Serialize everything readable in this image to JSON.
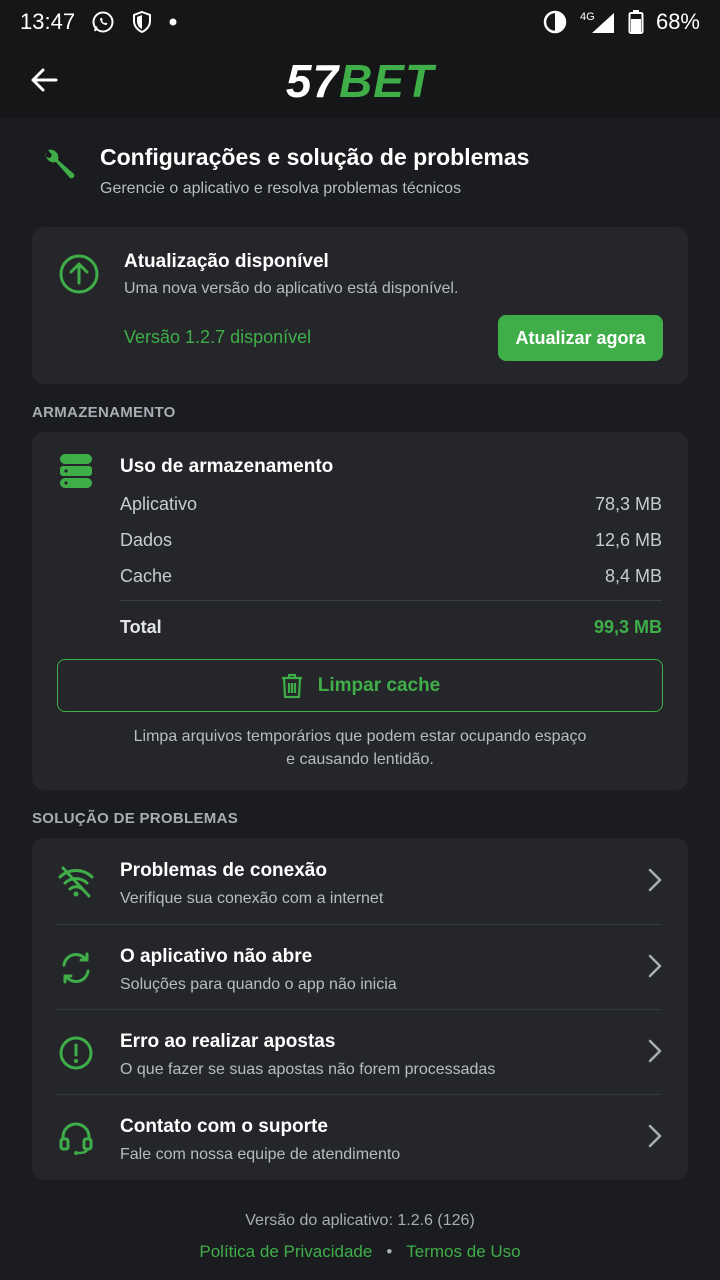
{
  "status_bar": {
    "time": "13:47",
    "network": "4G",
    "battery": "68%"
  },
  "app": {
    "logo_part1": "57",
    "logo_part2": "BET"
  },
  "header": {
    "title": "Configurações e solução de problemas",
    "subtitle": "Gerencie o aplicativo e resolva problemas técnicos"
  },
  "update": {
    "title": "Atualização disponível",
    "description": "Uma nova versão do aplicativo está disponível.",
    "version_text": "Versão 1.2.7 disponível",
    "button_label": "Atualizar agora"
  },
  "storage": {
    "section_label": "ARMAZENAMENTO",
    "title": "Uso de armazenamento",
    "rows": [
      {
        "label": "Aplicativo",
        "value": "78,3 MB"
      },
      {
        "label": "Dados",
        "value": "12,6 MB"
      },
      {
        "label": "Cache",
        "value": "8,4 MB"
      }
    ],
    "total_label": "Total",
    "total_value": "99,3 MB",
    "clear_button_label": "Limpar cache",
    "clear_note_line1": "Limpa arquivos temporários que podem estar ocupando espaço",
    "clear_note_line2": "e causando lentidão."
  },
  "troubleshooting": {
    "section_label": "SOLUÇÃO DE PROBLEMAS",
    "items": [
      {
        "title": "Problemas de conexão",
        "subtitle": "Verifique sua conexão com a internet",
        "icon": "wifi-off-icon"
      },
      {
        "title": "O aplicativo não abre",
        "subtitle": "Soluções para quando o app não inicia",
        "icon": "refresh-icon"
      },
      {
        "title": "Erro ao realizar apostas",
        "subtitle": "O que fazer se suas apostas não forem processadas",
        "icon": "alert-circle-icon"
      },
      {
        "title": "Contato com o suporte",
        "subtitle": "Fale com nossa equipe de atendimento",
        "icon": "headset-icon"
      }
    ]
  },
  "footer": {
    "version_text": "Versão do aplicativo: 1.2.6 (126)",
    "privacy_link": "Política de Privacidade",
    "separator": "•",
    "terms_link": "Termos de Uso"
  },
  "colors": {
    "accent": "#3fae49",
    "background": "#1a1c1f",
    "card": "#24262a"
  }
}
